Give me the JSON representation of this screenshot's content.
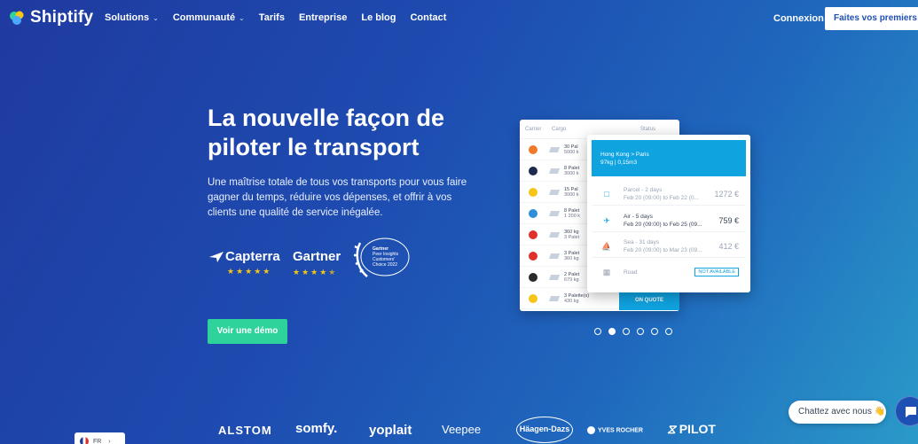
{
  "nav": {
    "brand": "Shiptify",
    "links": [
      {
        "label": "Solutions",
        "dropdown": true
      },
      {
        "label": "Communauté",
        "dropdown": true
      },
      {
        "label": "Tarifs",
        "dropdown": false
      },
      {
        "label": "Entreprise",
        "dropdown": false
      },
      {
        "label": "Le blog",
        "dropdown": false
      },
      {
        "label": "Contact",
        "dropdown": false
      }
    ],
    "login": "Connexion",
    "cta": "Faites vos premiers pas"
  },
  "hero": {
    "title": "La nouvelle façon de piloter le transport",
    "subtitle": "Une maîtrise totale de tous vos transports pour vous faire gagner du temps, réduire vos dépenses, et offrir à vos clients une qualité de service inégalée.",
    "demo_button": "Voir une démo"
  },
  "badges": {
    "capterra": {
      "name": "Capterra",
      "rating": 5
    },
    "gartner": {
      "name": "Gartner",
      "rating": 4.5
    },
    "gartner_award": {
      "line1": "Gartner",
      "line2": "Peer Insights",
      "line3": "Customers'",
      "line4": "Choice 2022"
    }
  },
  "mockup": {
    "headers": {
      "carrier": "Carrier",
      "cargo": "Cargo",
      "status": "Status"
    },
    "rows": [
      {
        "carrier_color": "#f07a2a",
        "line1": "30 Pal",
        "line2": "5000 k"
      },
      {
        "carrier_color": "#1d2b4f",
        "line1": "8 Palet",
        "line2": "3000 k"
      },
      {
        "carrier_color": "#f5c518",
        "line1": "15 Pal",
        "line2": "3000 k"
      },
      {
        "carrier_color": "#2e8fd8",
        "line1": "8 Palet",
        "line2": "1 200 k"
      },
      {
        "carrier_color": "#e0302c",
        "line1": "360 kg",
        "line2": "3 Palet"
      },
      {
        "carrier_color": "#e0302c",
        "line1": "3 Palet",
        "line2": "360 kg"
      },
      {
        "carrier_color": "#2b2b2b",
        "line1": "2 Palet",
        "line2": "679 kg"
      },
      {
        "carrier_color": "#f5c518",
        "line1": "3 Palette(s)",
        "line2": "430 kg"
      }
    ],
    "quote_button": "ON QUOTE",
    "popup": {
      "route": "Hong Kong > Paris",
      "load": "97kg | 0,15m3",
      "options": [
        {
          "icon": "parcel-icon",
          "title": "Parcel - 2 days",
          "detail": "Feb 20 (09:00) to Feb 22 (0...",
          "price": "1272 €",
          "active": false
        },
        {
          "icon": "plane-icon",
          "title": "Air - 5 days",
          "detail": "Feb 20 (09:00) to Feb 25 (09...",
          "price": "759 €",
          "active": true
        },
        {
          "icon": "ship-icon",
          "title": "Sea - 31 days",
          "detail": "Feb 20 (09:00) to Mar 23 (09...",
          "price": "412 €",
          "active": false
        },
        {
          "icon": "truck-icon",
          "title": "Road",
          "detail": "",
          "price": "",
          "badge": "NOT AVAILABLE",
          "active": false
        }
      ]
    }
  },
  "carousel": {
    "count": 6,
    "active_index": 1
  },
  "logos": [
    "ALSTOM",
    "somfy.",
    "yoplait",
    "Veepee",
    "Häagen-Dazs",
    "YVES ROCHER",
    "PILOT"
  ],
  "chat": {
    "label": "Chattez avec nous",
    "emoji": "👋"
  },
  "language": {
    "code": "FR"
  }
}
